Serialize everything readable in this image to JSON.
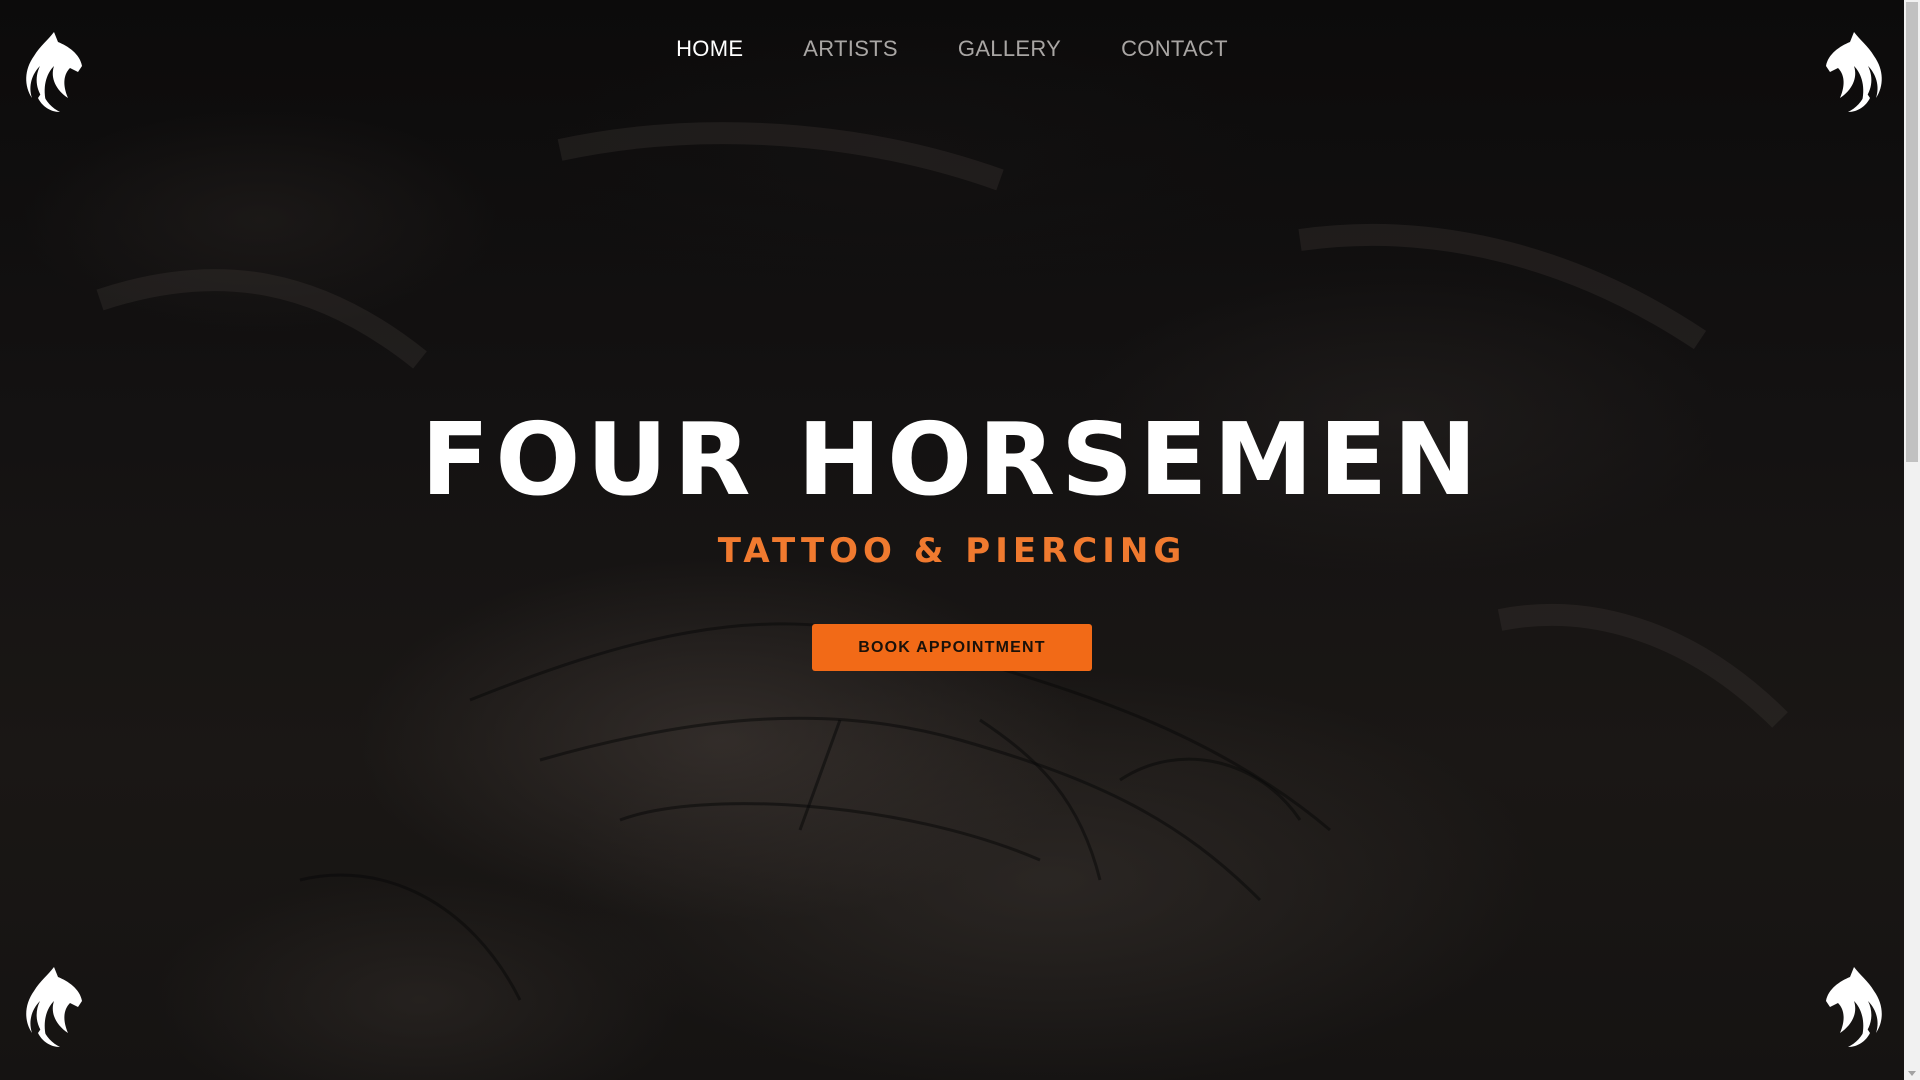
{
  "nav": {
    "items": [
      {
        "label": "HOME",
        "active": true
      },
      {
        "label": "ARTISTS",
        "active": false
      },
      {
        "label": "GALLERY",
        "active": false
      },
      {
        "label": "CONTACT",
        "active": false
      }
    ]
  },
  "hero": {
    "title": "FOUR HORSEMEN",
    "subtitle": "TATTOO & PIERCING",
    "cta_label": "BOOK APPOINTMENT"
  },
  "icons": {
    "corner_logo": "horse-head-icon"
  },
  "colors": {
    "accent": "#f26a17",
    "subtitle": "#f07a2f",
    "nav_active": "#ffffff",
    "nav_inactive": "#a9a6a4",
    "background": "#0b0a0a"
  }
}
